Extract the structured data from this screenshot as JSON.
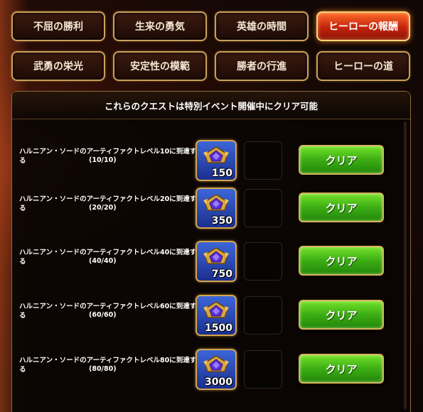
{
  "tabs": [
    {
      "label": "不屈の勝利",
      "active": false
    },
    {
      "label": "生来の勇気",
      "active": false
    },
    {
      "label": "英雄の時間",
      "active": false
    },
    {
      "label": "ヒーローの報酬",
      "active": true
    },
    {
      "label": "武勇の栄光",
      "active": false
    },
    {
      "label": "安定性の模範",
      "active": false
    },
    {
      "label": "勝者の行進",
      "active": false
    },
    {
      "label": "ヒーローの道",
      "active": false
    }
  ],
  "panel": {
    "header": "これらのクエストは特別イベント開催中にクリア可能"
  },
  "quests": [
    {
      "text": "ハルニアン・ソードのアーティファクトレベル10に到達する",
      "progress": "(10/10)",
      "reward_amount": "150",
      "claim_label": "クリア"
    },
    {
      "text": "ハルニアン・ソードのアーティファクトレベル20に到達する",
      "progress": "(20/20)",
      "reward_amount": "350",
      "claim_label": "クリア"
    },
    {
      "text": "ハルニアン・ソードのアーティファクトレベル40に到達する",
      "progress": "(40/40)",
      "reward_amount": "750",
      "claim_label": "クリア"
    },
    {
      "text": "ハルニアン・ソードのアーティファクトレベル60に到達する",
      "progress": "(60/60)",
      "reward_amount": "1500",
      "claim_label": "クリア"
    },
    {
      "text": "ハルニアン・ソードのアーティファクトレベル80に到達する",
      "progress": "(80/80)",
      "reward_amount": "3000",
      "claim_label": "クリア"
    }
  ],
  "colors": {
    "active_tab": "#c2240c",
    "claim_button": "#3cad14",
    "border_gold": "#c9a15a"
  },
  "icons": {
    "reward_icon": "blue-crystal-gem-icon"
  }
}
